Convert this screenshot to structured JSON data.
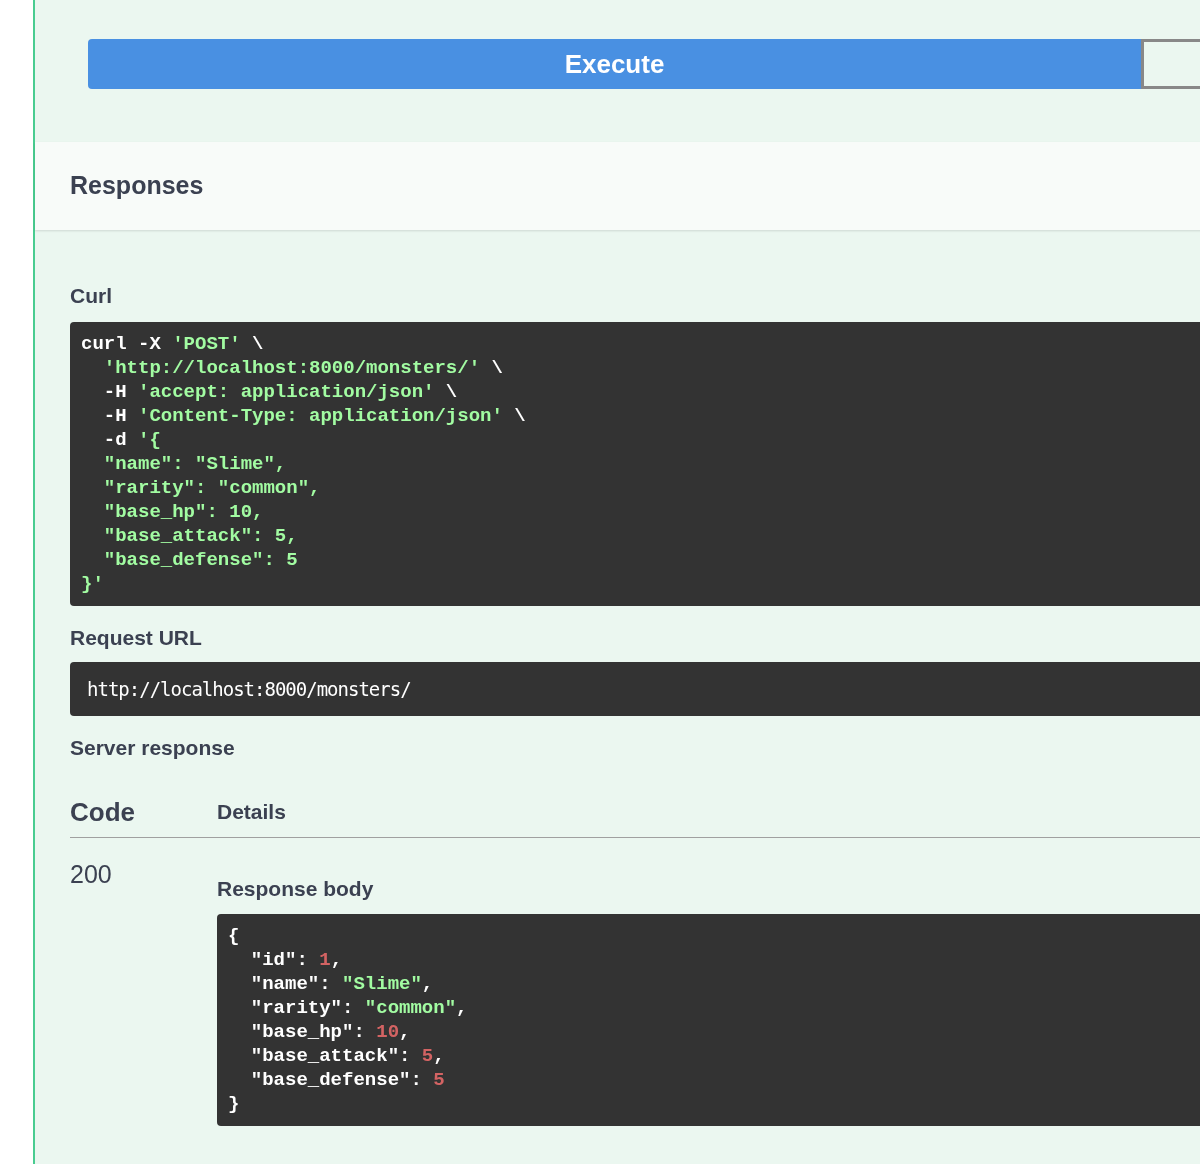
{
  "execute_button": {
    "label": "Execute"
  },
  "responses_header": {
    "title": "Responses"
  },
  "curl": {
    "label": "Curl",
    "lines": [
      [
        {
          "kind": "plain",
          "text": "curl -X "
        },
        {
          "kind": "string",
          "text": "'POST'"
        },
        {
          "kind": "plain",
          "text": " \\"
        }
      ],
      [
        {
          "kind": "string",
          "text": "  'http://localhost:8000/monsters/'"
        },
        {
          "kind": "plain",
          "text": " \\"
        }
      ],
      [
        {
          "kind": "plain",
          "text": "  -H "
        },
        {
          "kind": "string",
          "text": "'accept: application/json'"
        },
        {
          "kind": "plain",
          "text": " \\"
        }
      ],
      [
        {
          "kind": "plain",
          "text": "  -H "
        },
        {
          "kind": "string",
          "text": "'Content-Type: application/json'"
        },
        {
          "kind": "plain",
          "text": " \\"
        }
      ],
      [
        {
          "kind": "plain",
          "text": "  -d "
        },
        {
          "kind": "string",
          "text": "'{"
        }
      ],
      [
        {
          "kind": "string",
          "text": "  \"name\": \"Slime\","
        }
      ],
      [
        {
          "kind": "string",
          "text": "  \"rarity\": \"common\","
        }
      ],
      [
        {
          "kind": "string",
          "text": "  \"base_hp\": 10,"
        }
      ],
      [
        {
          "kind": "string",
          "text": "  \"base_attack\": 5,"
        }
      ],
      [
        {
          "kind": "string",
          "text": "  \"base_defense\": 5"
        }
      ],
      [
        {
          "kind": "string",
          "text": "}'"
        }
      ]
    ]
  },
  "request_url": {
    "label": "Request URL",
    "value": "http://localhost:8000/monsters/"
  },
  "server_response": {
    "label": "Server response",
    "columns": [
      "Code",
      "Details"
    ],
    "rows": [
      {
        "code": "200",
        "body_label": "Response body",
        "body_lines": [
          [
            {
              "kind": "plain",
              "text": "{"
            }
          ],
          [
            {
              "kind": "plain",
              "text": "  \"id\": "
            },
            {
              "kind": "number",
              "text": "1"
            },
            {
              "kind": "plain",
              "text": ","
            }
          ],
          [
            {
              "kind": "plain",
              "text": "  \"name\": "
            },
            {
              "kind": "string",
              "text": "\"Slime\""
            },
            {
              "kind": "plain",
              "text": ","
            }
          ],
          [
            {
              "kind": "plain",
              "text": "  \"rarity\": "
            },
            {
              "kind": "string",
              "text": "\"common\""
            },
            {
              "kind": "plain",
              "text": ","
            }
          ],
          [
            {
              "kind": "plain",
              "text": "  \"base_hp\": "
            },
            {
              "kind": "number",
              "text": "10"
            },
            {
              "kind": "plain",
              "text": ","
            }
          ],
          [
            {
              "kind": "plain",
              "text": "  \"base_attack\": "
            },
            {
              "kind": "number",
              "text": "5"
            },
            {
              "kind": "plain",
              "text": ","
            }
          ],
          [
            {
              "kind": "plain",
              "text": "  \"base_defense\": "
            },
            {
              "kind": "number",
              "text": "5"
            }
          ],
          [
            {
              "kind": "plain",
              "text": "}"
            }
          ]
        ]
      }
    ]
  }
}
